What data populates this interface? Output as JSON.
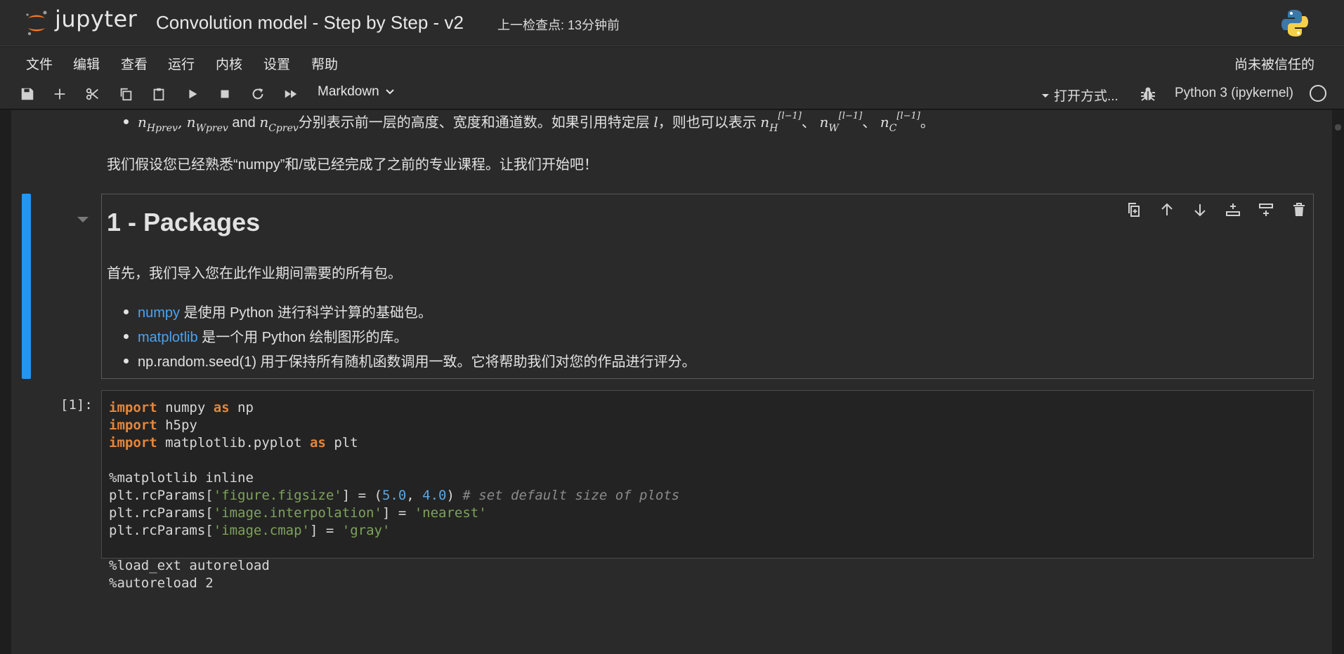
{
  "header": {
    "logo_text": "jupyter",
    "notebook_title": "Convolution model - Step by Step - v2",
    "checkpoint": "上一检查点: 13分钟前"
  },
  "menubar": {
    "items": [
      "文件",
      "编辑",
      "查看",
      "运行",
      "内核",
      "设置",
      "帮助"
    ],
    "trust_status": "尚未被信任的"
  },
  "toolbar": {
    "cell_type": "Markdown",
    "open_with": "打开方式...",
    "kernel_name": "Python 3 (ipykernel)",
    "icons": [
      "save-icon",
      "add-icon",
      "cut-icon",
      "copy-icon",
      "paste-icon",
      "run-icon",
      "stop-icon",
      "restart-icon",
      "run-all-icon"
    ]
  },
  "notebook": {
    "prev_cell": {
      "bullet_text": "分别表示前一层的高度、宽度和通道数。如果引用特定层",
      "bullet_then": "，则也可以表示",
      "bullet_end": "。",
      "math_nH": "n",
      "math_Hprev": "Hprev",
      "math_nW": "n",
      "math_Wprev": "Wprev",
      "math_and": "and",
      "math_nC": "n",
      "math_Cprev": "Cprev",
      "math_l": "l",
      "math_sep": "、",
      "math_sup": "[l−1]",
      "math_H": "H",
      "math_W": "W",
      "math_C": "C",
      "paragraph": "我们假设您已经熟悉“numpy”和/或已经完成了之前的专业课程。让我们开始吧！"
    },
    "md_cell": {
      "heading": "1 - Packages",
      "intro": "首先，我们导入您在此作业期间需要的所有包。",
      "bullets": [
        {
          "link": "numpy",
          "text": " 是使用 Python 进行科学计算的基础包。"
        },
        {
          "link": "matplotlib",
          "text": " 是一个用 Python 绘制图形的库。"
        },
        {
          "link": "",
          "text": "np.random.seed(1) 用于保持所有随机函数调用一致。它将帮助我们对您的作品进行评分。"
        }
      ],
      "tool_icons": [
        "duplicate-cell-icon",
        "move-up-icon",
        "move-down-icon",
        "insert-above-icon",
        "insert-below-icon",
        "delete-cell-icon"
      ]
    },
    "code_cell": {
      "prompt": "[1]:",
      "lines": [
        [
          [
            "kw",
            "import"
          ],
          [
            "",
            " numpy "
          ],
          [
            "kw",
            "as"
          ],
          [
            "",
            " np"
          ]
        ],
        [
          [
            "kw",
            "import"
          ],
          [
            "",
            " h5py"
          ]
        ],
        [
          [
            "kw",
            "import"
          ],
          [
            "",
            " matplotlib.pyplot "
          ],
          [
            "kw",
            "as"
          ],
          [
            "",
            " plt"
          ]
        ],
        [],
        [
          [
            "",
            "%matplotlib inline"
          ]
        ],
        [
          [
            "",
            "plt.rcParams["
          ],
          [
            "str",
            "'figure.figsize'"
          ],
          [
            "",
            "] = ("
          ],
          [
            "num",
            "5.0"
          ],
          [
            "",
            ", "
          ],
          [
            "num",
            "4.0"
          ],
          [
            "",
            ") "
          ],
          [
            "cmt",
            "# set default size of plots"
          ]
        ],
        [
          [
            "",
            "plt.rcParams["
          ],
          [
            "str",
            "'image.interpolation'"
          ],
          [
            "",
            "] = "
          ],
          [
            "str",
            "'nearest'"
          ]
        ],
        [
          [
            "",
            "plt.rcParams["
          ],
          [
            "str",
            "'image.cmap'"
          ],
          [
            "",
            "] = "
          ],
          [
            "str",
            "'gray'"
          ]
        ],
        [],
        [
          [
            "",
            "%load_ext autoreload"
          ]
        ],
        [
          [
            "",
            "%autoreload 2"
          ]
        ]
      ]
    }
  },
  "colors": {
    "accent": "#2196f3",
    "link": "#4aa3f0",
    "keyword": "#e5863a",
    "string": "#7ea35b",
    "number": "#5ca6e0",
    "comment": "#8a8a8a",
    "jupyter_orange": "#f37726"
  }
}
